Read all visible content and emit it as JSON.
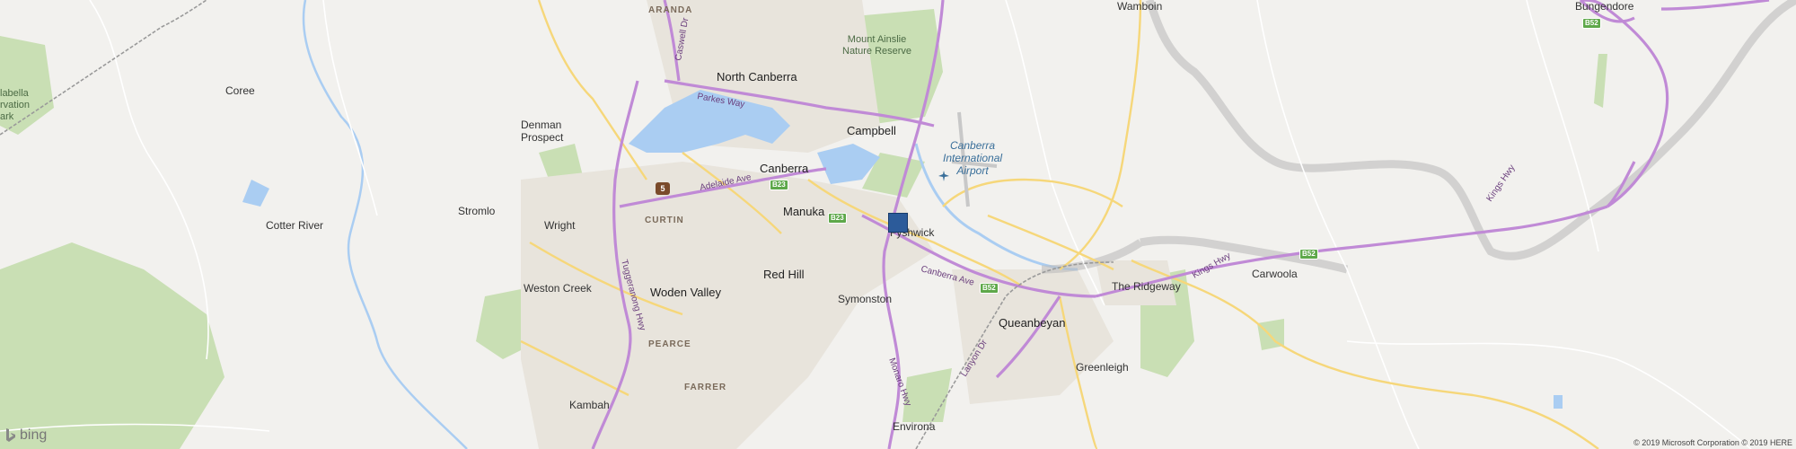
{
  "map": {
    "places": {
      "aranda": "ARANDA",
      "mount_ainslie": [
        "Mount Ainslie",
        "Nature Reserve"
      ],
      "wamboin": "Wamboin",
      "bungendore": "Bungendore",
      "north_canberra": "North Canberra",
      "coree": "Coree",
      "mulligans": [
        "labella",
        "rvation",
        "ark"
      ],
      "campbell": "Campbell",
      "denman_prospect": [
        "Denman",
        "Prospect"
      ],
      "canberra_airport": [
        "Canberra",
        "International",
        "Airport"
      ],
      "canberra": "Canberra",
      "stromlo": "Stromlo",
      "curtin": "CURTIN",
      "manuka": "Manuka",
      "wright": "Wright",
      "cotter_river": "Cotter River",
      "fyshwick": "Fyshwick",
      "red_hill": "Red Hill",
      "weston_creek": "Weston Creek",
      "woden_valley": "Woden Valley",
      "the_ridgeway": "The Ridgeway",
      "carwoola": "Carwoola",
      "symonston": "Symonston",
      "queanbeyan": "Queanbeyan",
      "pearce": "PEARCE",
      "greenleigh": "Greenleigh",
      "farrer": "FARRER",
      "kambah": "Kambah",
      "environa": "Environa"
    },
    "roads": {
      "parkes_way": "Parkes Way",
      "adelaide_ave": "Adelaide Ave",
      "caswell_dr": "Caswell Dr",
      "tuggeranong_hwy": "Tuggeranong Hwy",
      "canberra_ave": "Canberra Ave",
      "kings_hwy_1": "Kings Hwy",
      "kings_hwy_2": "Kings Hwy",
      "monaro_hwy": "Monaro Hwy",
      "lanyon_dr": "Lanyon Dr"
    },
    "shields": {
      "b23_a": "B23",
      "b23_b": "B23",
      "b52_a": "B52",
      "b52_b": "B52",
      "b52_c": "B52",
      "route5": "5"
    },
    "branding": "bing",
    "copyright": "© 2019 Microsoft Corporation © 2019 HERE",
    "colors": {
      "background": "#f2f1ee",
      "park": "#c9dfb4",
      "water": "#aacdf2",
      "highway": "#c08ad6",
      "major_road": "#f6d77a",
      "marker": "#2c5b9a"
    }
  }
}
